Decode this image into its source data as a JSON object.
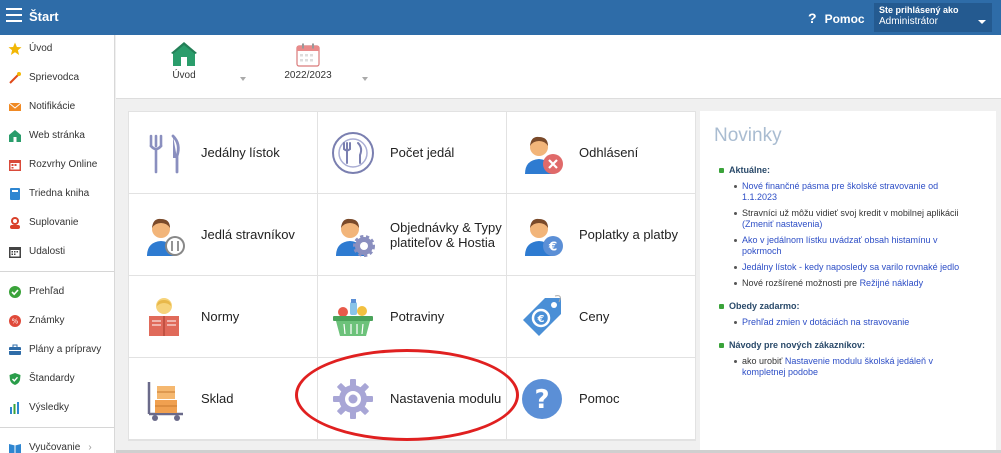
{
  "topbar": {
    "title": "Štart",
    "help_label": "Pomoc",
    "user_line1": "Ste prihlásený ako",
    "user_line2": "Administrátor"
  },
  "sidebar": {
    "items": [
      {
        "label": "Úvod",
        "icon": "star-icon",
        "color": "#f2b705"
      },
      {
        "label": "Sprievodca",
        "icon": "wand-icon",
        "color": "#e04a1a"
      },
      {
        "label": "Notifikácie",
        "icon": "envelope-icon",
        "color": "#f08a24"
      },
      {
        "label": "Web stránka",
        "icon": "home-icon",
        "color": "#2a9d6b"
      },
      {
        "label": "Rozvrhy Online",
        "icon": "calendar-icon",
        "color": "#d94a3a"
      },
      {
        "label": "Triedna kniha",
        "icon": "book-icon",
        "color": "#2e86d1"
      },
      {
        "label": "Suplovanie",
        "icon": "person-icon",
        "color": "#d9402a"
      },
      {
        "label": "Udalosti",
        "icon": "calendar-grid-icon",
        "color": "#444444"
      }
    ],
    "items2": [
      {
        "label": "Prehľad",
        "icon": "check-circle-icon",
        "color": "#3aa33a"
      },
      {
        "label": "Známky",
        "icon": "badge-icon",
        "color": "#e04a3a"
      },
      {
        "label": "Plány a prípravy",
        "icon": "briefcase-icon",
        "color": "#2e6ca8"
      },
      {
        "label": "Štandardy",
        "icon": "shield-icon",
        "color": "#2a9d4a"
      },
      {
        "label": "Výsledky",
        "icon": "bar-chart-icon",
        "color": "#2e86d1"
      },
      {
        "label": "Vyučovanie",
        "icon": "book-open-icon",
        "color": "#2e86d1"
      }
    ]
  },
  "quickbar": {
    "home_label": "Úvod",
    "year_label": "2022/2023"
  },
  "tiles": [
    {
      "label": "Jedálny lístok",
      "icon": "cutlery-icon"
    },
    {
      "label": "Počet jedál",
      "icon": "plate-icon"
    },
    {
      "label": "Odhlásení",
      "icon": "person-cancel-icon"
    },
    {
      "label": "Jedlá stravníkov",
      "icon": "person-cutlery-icon"
    },
    {
      "label": "Objednávky & Typy platiteľov & Hostia",
      "icon": "person-gear-icon"
    },
    {
      "label": "Poplatky a platby",
      "icon": "person-euro-icon"
    },
    {
      "label": "Normy",
      "icon": "reader-icon"
    },
    {
      "label": "Potraviny",
      "icon": "basket-icon"
    },
    {
      "label": "Ceny",
      "icon": "price-tag-icon"
    },
    {
      "label": "Sklad",
      "icon": "warehouse-cart-icon"
    },
    {
      "label": "Nastavenia modulu",
      "icon": "gear-icon"
    },
    {
      "label": "Pomoc",
      "icon": "help-circle-icon"
    }
  ],
  "news": {
    "title": "Novinky",
    "sections": [
      {
        "heading": "Aktuálne:",
        "items": [
          {
            "text": "",
            "link": "Nové finančné pásma pre školské stravovanie od 1.1.2023",
            "after": ""
          },
          {
            "text": "Stravníci už môžu vidieť svoj kredit v mobilnej aplikácii",
            "link": "(Zmeniť nastavenia)",
            "after": ""
          },
          {
            "text": "",
            "link": "Ako v jedálnom lístku uvádzať obsah histamínu v pokrmoch",
            "after": ""
          },
          {
            "text": "",
            "link": "Jedálny lístok - kedy naposledy sa varilo rovnaké jedlo",
            "after": ""
          },
          {
            "text": "Nové rozšírené možnosti pre ",
            "link": "Režijné náklady",
            "after": ""
          }
        ]
      },
      {
        "heading": "Obedy zadarmo:",
        "items": [
          {
            "text": "",
            "link": "Prehľad zmien v dotáciách na stravovanie",
            "after": ""
          }
        ]
      },
      {
        "heading": "Návody pre nových zákazníkov:",
        "items": [
          {
            "text": "ako urobiť ",
            "link": "Nastavenie modulu školská jedáleň v kompletnej podobe",
            "after": ""
          }
        ]
      }
    ]
  },
  "colors": {
    "topbar": "#2e6ca8",
    "link": "#2d4ec6",
    "highlight": "#e02020"
  }
}
